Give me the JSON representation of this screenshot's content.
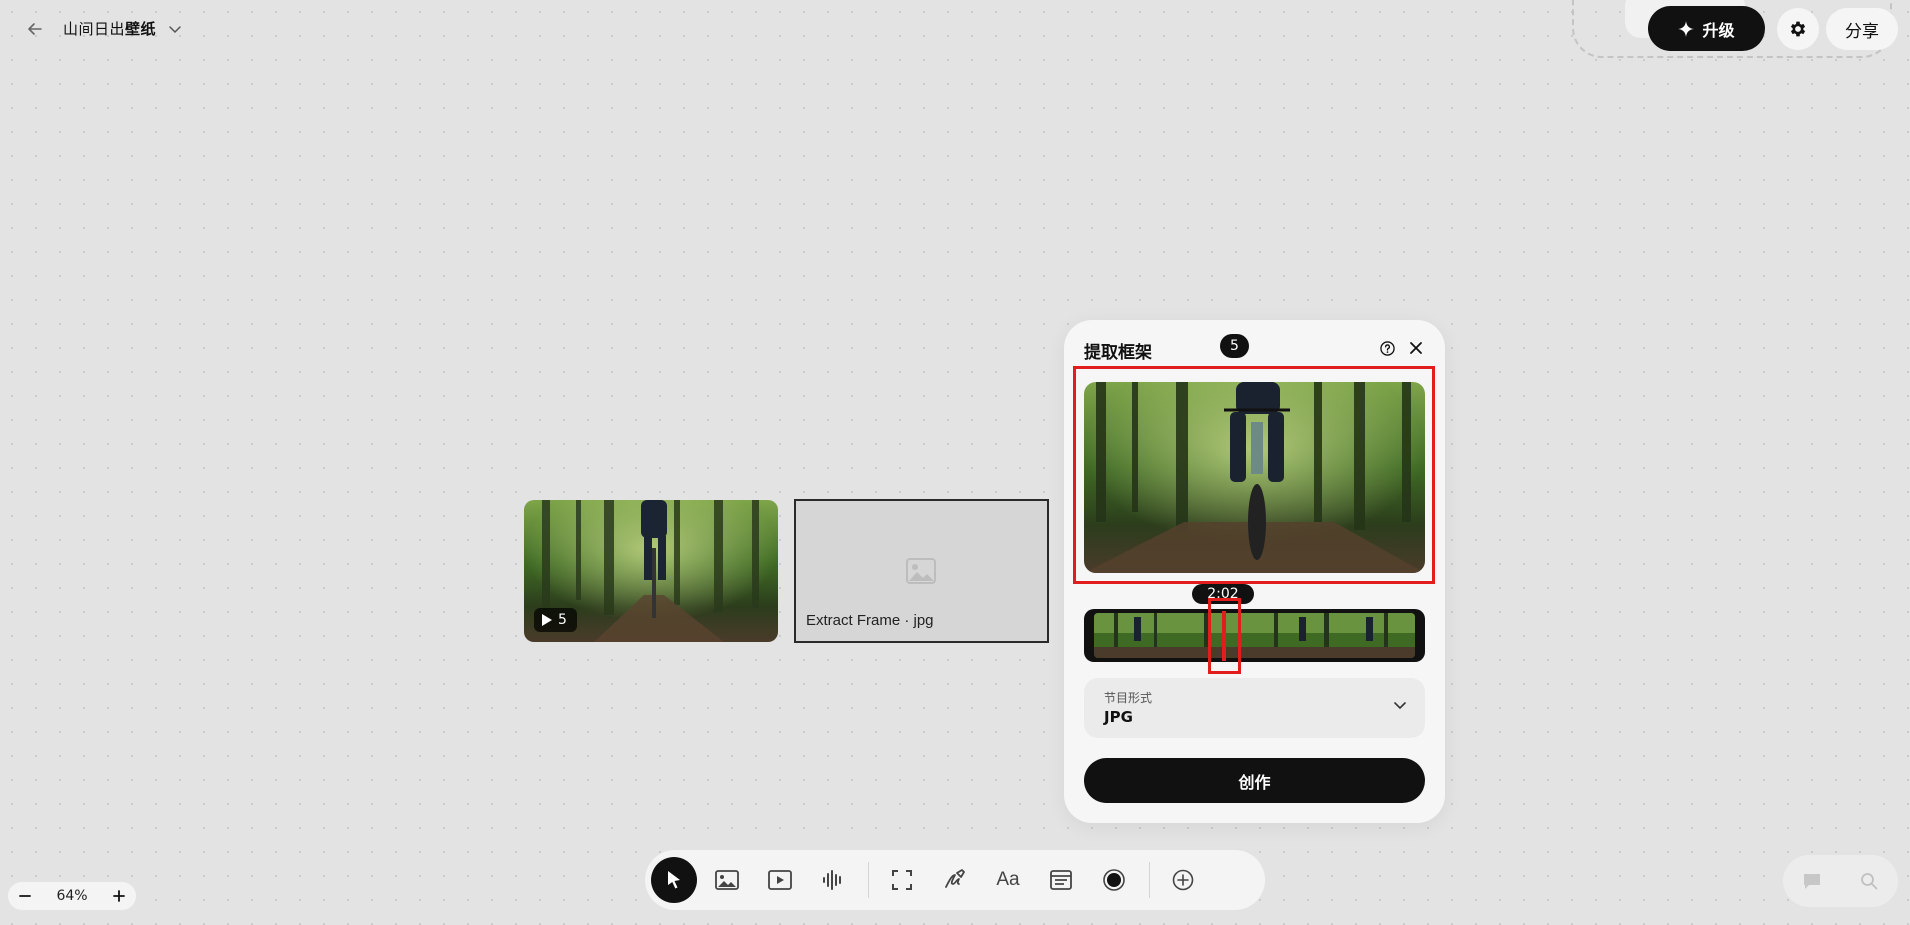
{
  "header": {
    "back_icon": "arrow-left-icon",
    "project_name_part1": "山间日出",
    "project_name_part2": "壁纸",
    "upgrade_label": "升级",
    "share_label": "分享"
  },
  "canvas": {
    "video_node": {
      "duration_label": "5"
    },
    "frame_node": {
      "caption": "Extract Frame · jpg"
    }
  },
  "panel": {
    "title": "提取框架",
    "time_tooltip": "2:02",
    "strip_badge": "5",
    "format_label": "节目形式",
    "format_value": "JPG",
    "create_label": "创作"
  },
  "toolbar": {
    "tools": [
      "select-tool",
      "image-tool",
      "video-tool",
      "audio-tool",
      "frame-tool",
      "draw-tool",
      "text-tool",
      "note-tool",
      "record-tool",
      "add-tool"
    ],
    "text_tool_label": "Aa"
  },
  "zoom": {
    "value": "64%"
  },
  "colors": {
    "accent": "#111111",
    "highlight": "#e11d1d",
    "canvas": "#e3e3e3"
  }
}
